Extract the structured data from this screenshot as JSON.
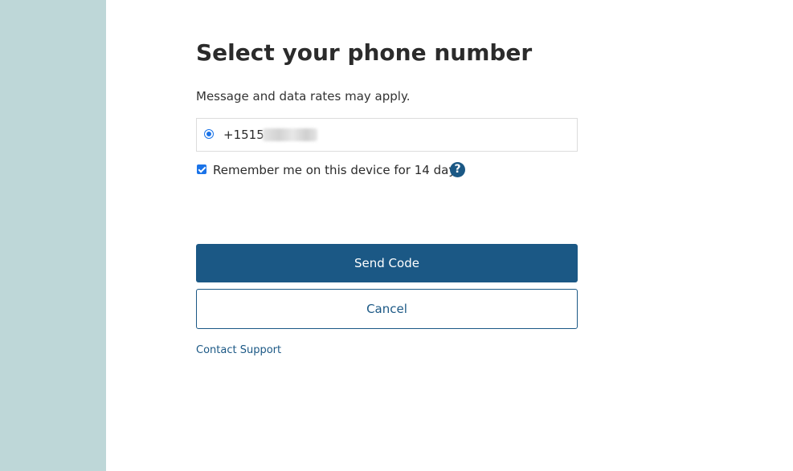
{
  "page": {
    "title": "Select your phone number",
    "subtitle": "Message and data rates may apply."
  },
  "phone_option": {
    "selected": true,
    "number_visible": "+1515",
    "number_obscured": true
  },
  "remember": {
    "checked": true,
    "label": "Remember me on this device for 14 days",
    "help_glyph": "?"
  },
  "actions": {
    "send_code_label": "Send Code",
    "cancel_label": "Cancel",
    "contact_support_label": "Contact Support"
  },
  "colors": {
    "side_panel": "#bed7d8",
    "primary": "#1b5885",
    "control_accent": "#1a73e8"
  },
  "icons": {
    "radio": "radio-selected-icon",
    "checkbox": "checkbox-checked-icon",
    "help": "question-circle-icon"
  }
}
